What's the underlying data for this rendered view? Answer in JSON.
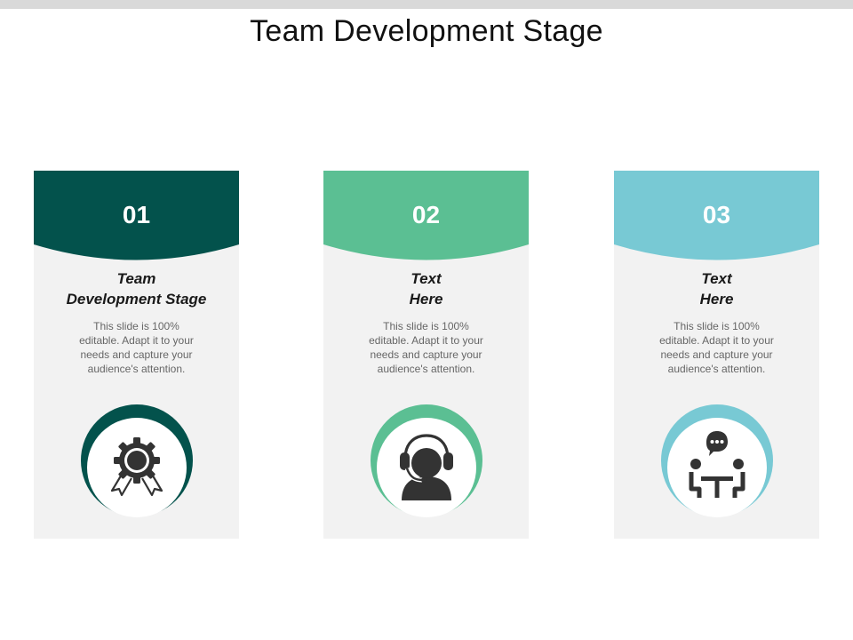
{
  "title": "Team Development Stage",
  "colors": {
    "card1": "#03524c",
    "card2": "#5bbf93",
    "card3": "#78c9d4",
    "card_bg": "#f2f2f2",
    "icon": "#333333"
  },
  "cards": [
    {
      "number": "01",
      "heading_line1": "Team",
      "heading_line2": "Development Stage",
      "description": "This slide is 100% editable. Adapt it to your needs and capture your audience's attention.",
      "icon": "gear-ribbon-award-icon"
    },
    {
      "number": "02",
      "heading_line1": "Text",
      "heading_line2": "Here",
      "description": "This slide is 100% editable. Adapt it to your needs and capture your audience's attention.",
      "icon": "headset-support-icon"
    },
    {
      "number": "03",
      "heading_line1": "Text",
      "heading_line2": "Here",
      "description": "This slide is 100% editable. Adapt it to your needs and capture your audience's attention.",
      "icon": "meeting-chat-icon"
    }
  ]
}
